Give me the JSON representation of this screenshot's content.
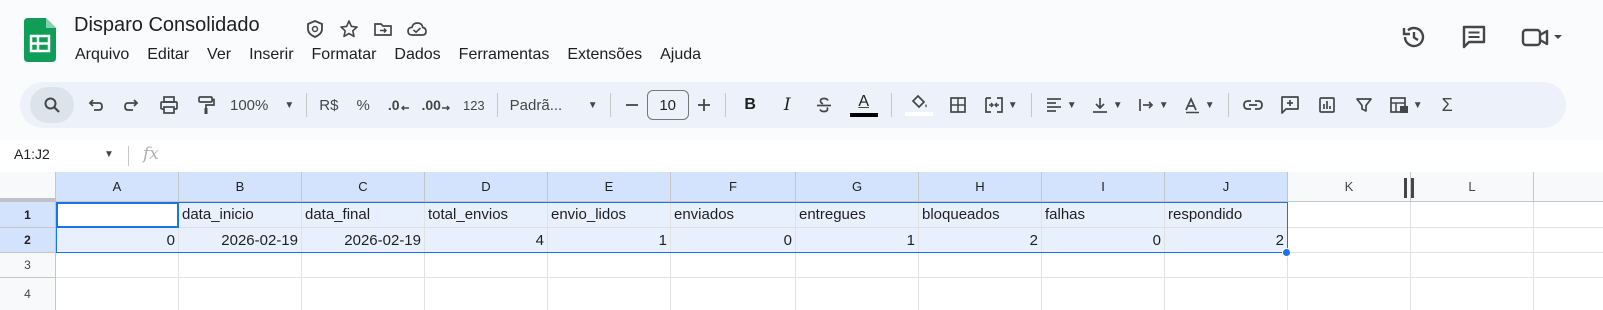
{
  "doc": {
    "title": "Disparo Consolidado"
  },
  "title_icons": [
    "at-badge-icon",
    "star-icon",
    "move-folder-icon",
    "cloud-saved-icon"
  ],
  "menu": [
    "Arquivo",
    "Editar",
    "Ver",
    "Inserir",
    "Formatar",
    "Dados",
    "Ferramentas",
    "Extensões",
    "Ajuda"
  ],
  "right_actions": [
    "history-icon",
    "comment-icon",
    "meet-video-icon"
  ],
  "toolbar": {
    "zoom": "100%",
    "currency": "R$",
    "percent": "%",
    "dec_decrease": ".0",
    "dec_increase": ".00",
    "number_format": "123",
    "font": "Padrã...",
    "font_size": "10",
    "bold": "B",
    "italic": "I",
    "text_color_letter": "A",
    "sum": "Σ"
  },
  "formula_bar": {
    "name_box": "A1:J2",
    "fx": "fx"
  },
  "colors": {
    "accent": "#1a73e8",
    "selection": "#d3e3fd",
    "sheets_green": "#0f9d58"
  },
  "grid": {
    "columns": [
      "A",
      "B",
      "C",
      "D",
      "E",
      "F",
      "G",
      "H",
      "I",
      "J",
      "K",
      "L"
    ],
    "rows": [
      "1",
      "2",
      "3",
      "4"
    ],
    "header_row": [
      "",
      "data_inicio",
      "data_final",
      "total_envios",
      "envio_lidos",
      "enviados",
      "entregues",
      "bloqueados",
      "falhas",
      "respondido"
    ],
    "data_row": [
      "0",
      "2026-02-19",
      "2026-02-19",
      "4",
      "1",
      "0",
      "1",
      "2",
      "0",
      "2"
    ]
  }
}
